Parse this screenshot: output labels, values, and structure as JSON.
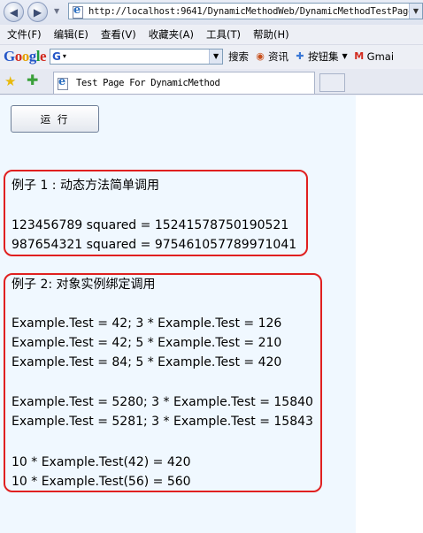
{
  "browser": {
    "address_url": "http://localhost:9641/DynamicMethodWeb/DynamicMethodTestPage",
    "menu": [
      "文件(F)",
      "编辑(E)",
      "查看(V)",
      "收藏夹(A)",
      "工具(T)",
      "帮助(H)"
    ],
    "google_toolbar": {
      "logo": [
        "G",
        "o",
        "o",
        "g",
        "l",
        "e"
      ],
      "search_value": "",
      "search_label": "搜索",
      "items": [
        "资讯",
        "按钮集",
        "Gmai"
      ]
    },
    "tab_title": "Test Page For DynamicMethod"
  },
  "page": {
    "run_button": "运 行",
    "example1": {
      "title": "例子 1 : 动态方法简单调用",
      "lines": [
        "123456789 squared = 15241578750190521",
        "987654321 squared = 975461057789971041"
      ]
    },
    "example2": {
      "title": "例子 2: 对象实例绑定调用",
      "lines": [
        "Example.Test = 42; 3 * Example.Test = 126",
        "Example.Test = 42; 5 * Example.Test = 210",
        "Example.Test = 84; 5 * Example.Test = 420",
        "Example.Test = 5280; 3 * Example.Test = 15840",
        "Example.Test = 5281; 3 * Example.Test = 15843",
        "10 * Example.Test(42) = 420",
        "10 * Example.Test(56) = 560"
      ]
    }
  },
  "colors": {
    "panel_border": "#e02020",
    "content_background": "#f0f8ff"
  }
}
